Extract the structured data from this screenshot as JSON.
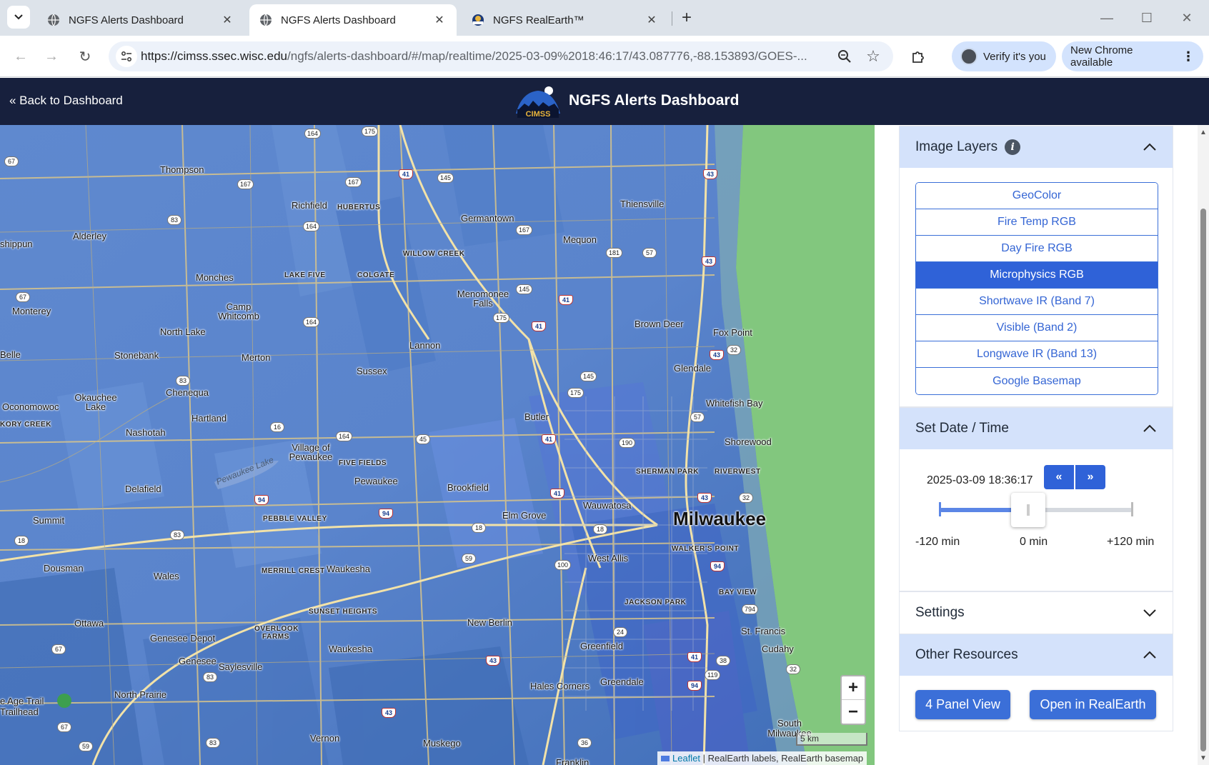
{
  "browser": {
    "tabs": [
      {
        "title": "NGFS Alerts Dashboard",
        "active": false
      },
      {
        "title": "NGFS Alerts Dashboard",
        "active": true
      },
      {
        "title": "NGFS RealEarth™",
        "active": false
      }
    ],
    "url_host": "https://cimss.ssec.wisc.edu",
    "url_path": "/ngfs/alerts-dashboard/#/map/realtime/2025-03-09%2018:46:17/43.087776,-88.153893/GOES-...",
    "verify_label": "Verify it's you",
    "update_label": "New Chrome available"
  },
  "header": {
    "back_label": "« Back to Dashboard",
    "logo_text": "CIMSS",
    "title": "NGFS Alerts Dashboard"
  },
  "map": {
    "places": [
      {
        "name": "Thompson",
        "style": "normal"
      },
      {
        "name": "Richfield",
        "style": "normal"
      },
      {
        "name": "HUBERTUS",
        "style": "small"
      },
      {
        "name": "Germantown",
        "style": "normal"
      },
      {
        "name": "Thiensville",
        "style": "normal"
      },
      {
        "name": "Alderley",
        "style": "normal"
      },
      {
        "name": "shippun",
        "style": "normal"
      },
      {
        "name": "Mequon",
        "style": "normal"
      },
      {
        "name": "WILLOW CREEK",
        "style": "small"
      },
      {
        "name": "Monches",
        "style": "normal"
      },
      {
        "name": "LAKE FIVE",
        "style": "small"
      },
      {
        "name": "COLGATE",
        "style": "small"
      },
      {
        "name": "Menomonee Falls",
        "style": "normal"
      },
      {
        "name": "Camp Whitcomb",
        "style": "normal"
      },
      {
        "name": "Monterey",
        "style": "normal"
      },
      {
        "name": "Brown Deer",
        "style": "normal"
      },
      {
        "name": "North Lake",
        "style": "normal"
      },
      {
        "name": "Fox Point",
        "style": "normal"
      },
      {
        "name": "Lannon",
        "style": "normal"
      },
      {
        "name": "Belle",
        "style": "normal"
      },
      {
        "name": "Stonebank",
        "style": "normal"
      },
      {
        "name": "Merton",
        "style": "normal"
      },
      {
        "name": "Glendale",
        "style": "normal"
      },
      {
        "name": "Sussex",
        "style": "normal"
      },
      {
        "name": "Chenequa",
        "style": "normal"
      },
      {
        "name": "Okauchee Lake",
        "style": "normal"
      },
      {
        "name": "Oconomowoc",
        "style": "normal"
      },
      {
        "name": "Whitefish Bay",
        "style": "normal"
      },
      {
        "name": "KORY CREEK",
        "style": "small"
      },
      {
        "name": "Hartland",
        "style": "normal"
      },
      {
        "name": "Butler",
        "style": "normal"
      },
      {
        "name": "Nashotah",
        "style": "normal"
      },
      {
        "name": "Shorewood",
        "style": "normal"
      },
      {
        "name": "Village of Pewaukee",
        "style": "normal"
      },
      {
        "name": "FIVE FIELDS",
        "style": "small"
      },
      {
        "name": "SHERMAN PARK",
        "style": "small"
      },
      {
        "name": "RIVERWEST",
        "style": "small"
      },
      {
        "name": "Pewaukee Lake",
        "style": "lake"
      },
      {
        "name": "Pewaukee",
        "style": "normal"
      },
      {
        "name": "Brookfield",
        "style": "normal"
      },
      {
        "name": "Delafield",
        "style": "normal"
      },
      {
        "name": "Wauwatosa",
        "style": "normal"
      },
      {
        "name": "Elm Grove",
        "style": "normal"
      },
      {
        "name": "Milwaukee",
        "style": "big"
      },
      {
        "name": "PEBBLE VALLEY",
        "style": "small"
      },
      {
        "name": "Summit",
        "style": "normal"
      },
      {
        "name": "West Allis",
        "style": "normal"
      },
      {
        "name": "WALKER'S POINT",
        "style": "small"
      },
      {
        "name": "Dousman",
        "style": "normal"
      },
      {
        "name": "MERRILL CREST",
        "style": "small"
      },
      {
        "name": "Waukesha",
        "style": "normal"
      },
      {
        "name": "Wales",
        "style": "normal"
      },
      {
        "name": "BAY VIEW",
        "style": "small"
      },
      {
        "name": "JACKSON PARK",
        "style": "small"
      },
      {
        "name": "SUNSET HEIGHTS",
        "style": "small"
      },
      {
        "name": "Ottawa",
        "style": "normal"
      },
      {
        "name": "New Berlin",
        "style": "normal"
      },
      {
        "name": "OVERLOOK FARMS",
        "style": "small"
      },
      {
        "name": "Genesee Depot",
        "style": "normal"
      },
      {
        "name": "St. Francis",
        "style": "normal"
      },
      {
        "name": "Greenfield",
        "style": "normal"
      },
      {
        "name": "Waukesha",
        "style": "normal"
      },
      {
        "name": "Cudahy",
        "style": "normal"
      },
      {
        "name": "Genesee",
        "style": "normal"
      },
      {
        "name": "Saylesville",
        "style": "normal"
      },
      {
        "name": "Greendale",
        "style": "normal"
      },
      {
        "name": "Hales Corners",
        "style": "normal"
      },
      {
        "name": "North Prairie",
        "style": "normal"
      },
      {
        "name": "e Age Trail Trailhead",
        "style": "normal"
      },
      {
        "name": "South Milwaukee",
        "style": "normal"
      },
      {
        "name": "Vernon",
        "style": "normal"
      },
      {
        "name": "Muskego",
        "style": "normal"
      },
      {
        "name": "Franklin",
        "style": "normal"
      }
    ],
    "shields": [
      "164",
      "175",
      "67",
      "167",
      "167",
      "41",
      "145",
      "43",
      "83",
      "164",
      "167",
      "181",
      "57",
      "43",
      "67",
      "145",
      "41",
      "175",
      "41",
      "164",
      "43",
      "32",
      "83",
      "145",
      "175",
      "57",
      "16",
      "164",
      "45",
      "41",
      "190",
      "43",
      "32",
      "94",
      "94",
      "41",
      "18",
      "18",
      "83",
      "18",
      "59",
      "100",
      "94",
      "24",
      "794",
      "43",
      "41",
      "38",
      "119",
      "32",
      "67",
      "83",
      "94",
      "43",
      "67",
      "59",
      "83",
      "36"
    ],
    "zoom_in": "+",
    "zoom_out": "−",
    "scale_label": "5 km",
    "attribution_link": "Leaflet",
    "attribution_text": " | RealEarth labels, RealEarth basemap"
  },
  "sidebar": {
    "image_layers": {
      "title": "Image Layers",
      "info": "i",
      "layers": [
        {
          "label": "GeoColor",
          "selected": false
        },
        {
          "label": "Fire Temp RGB",
          "selected": false
        },
        {
          "label": "Day Fire RGB",
          "selected": false
        },
        {
          "label": "Microphysics RGB",
          "selected": true
        },
        {
          "label": "Shortwave IR (Band 7)",
          "selected": false
        },
        {
          "label": "Visible (Band 2)",
          "selected": false
        },
        {
          "label": "Longwave IR (Band 13)",
          "selected": false
        },
        {
          "label": "Google Basemap",
          "selected": false
        }
      ]
    },
    "datetime": {
      "title": "Set Date / Time",
      "value": "2025-03-09 18:36:17",
      "prev_label": "«",
      "next_label": "»",
      "slider_fraction": 0.46,
      "min_label": "-120 min",
      "mid_label": "0 min",
      "max_label": "+120 min"
    },
    "settings": {
      "title": "Settings"
    },
    "resources": {
      "title": "Other Resources",
      "four_panel_label": "4 Panel View",
      "realearth_label": "Open in RealEarth"
    }
  },
  "colors": {
    "header_bg": "#17203d",
    "accent": "#2f62d8",
    "panel_head": "#d4e2fb",
    "map_blue": "#5b86cc",
    "map_green": "#82c77e"
  }
}
